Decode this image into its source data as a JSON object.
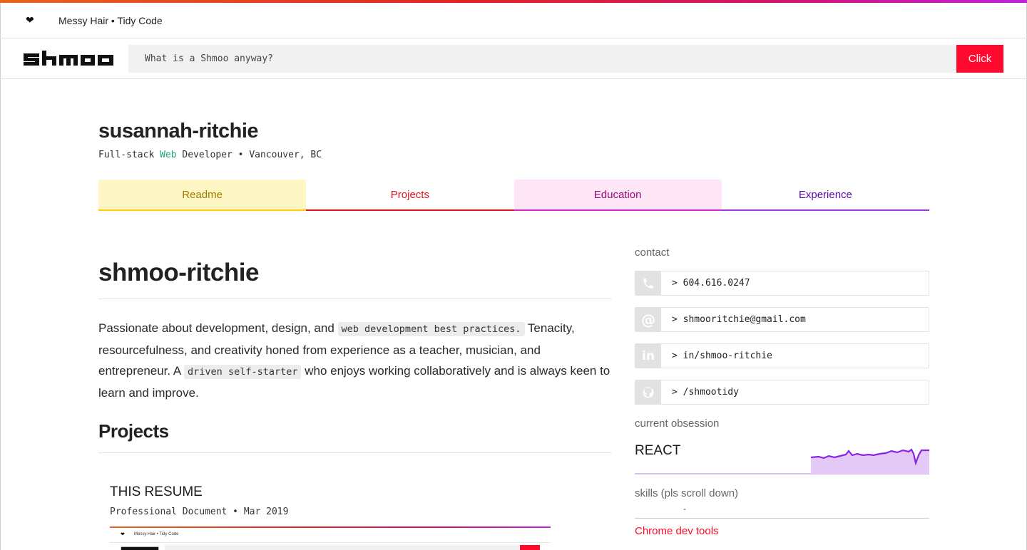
{
  "colors": {
    "accent_red": "#ff0a2e",
    "web_green": "#22a47a",
    "readme": "#ffd000",
    "projects": "#e0121e",
    "education": "#d62ac6",
    "experience": "#9a35e8"
  },
  "mini_header": {
    "icon": "heart-icon",
    "tagline": "Messy Hair • Tidy Code"
  },
  "header": {
    "logo_text": "shmoo",
    "search_value": "What is a Shmoo anyway?",
    "search_button": "Click"
  },
  "profile": {
    "name": "susannah-ritchie",
    "subtitle_pre": "Full-stack ",
    "subtitle_accent": "Web",
    "subtitle_post": " Developer • Vancouver, BC"
  },
  "tabs": [
    {
      "label": "Readme"
    },
    {
      "label": "Projects"
    },
    {
      "label": "Education"
    },
    {
      "label": "Experience"
    }
  ],
  "main": {
    "title": "shmoo-ritchie",
    "bio_1": "Passionate about development, design, and ",
    "bio_code_1": "web development best practices.",
    "bio_2": " Tenacity, resourcefulness, and creativity honed from experience as a teacher, musician, and entrepreneur. A ",
    "bio_code_2": "driven self-starter",
    "bio_3": " who enjoys working collaboratively and is always keen to learn and improve.",
    "projects_heading": "Projects",
    "project": {
      "title": "THIS RESUME",
      "subtitle": "Professional Document • Mar 2019",
      "thumb_tagline": "Messy Hair • Tidy Code"
    }
  },
  "sidebar": {
    "contact_label": "contact",
    "contacts": [
      {
        "icon": "phone-icon",
        "text": ">  604.616.0247"
      },
      {
        "icon": "at-icon",
        "text": ">  shmooritchie@gmail.com"
      },
      {
        "icon": "linkedin-icon",
        "text": ">  in/shmoo-ritchie"
      },
      {
        "icon": "github-icon",
        "text": ">  /shmootidy"
      }
    ],
    "obsession_label": "current obsession",
    "obsession": "REACT",
    "skills_label": "skills (pls scroll down)",
    "skills_dash": "-",
    "skill_link": "Chrome dev tools"
  }
}
